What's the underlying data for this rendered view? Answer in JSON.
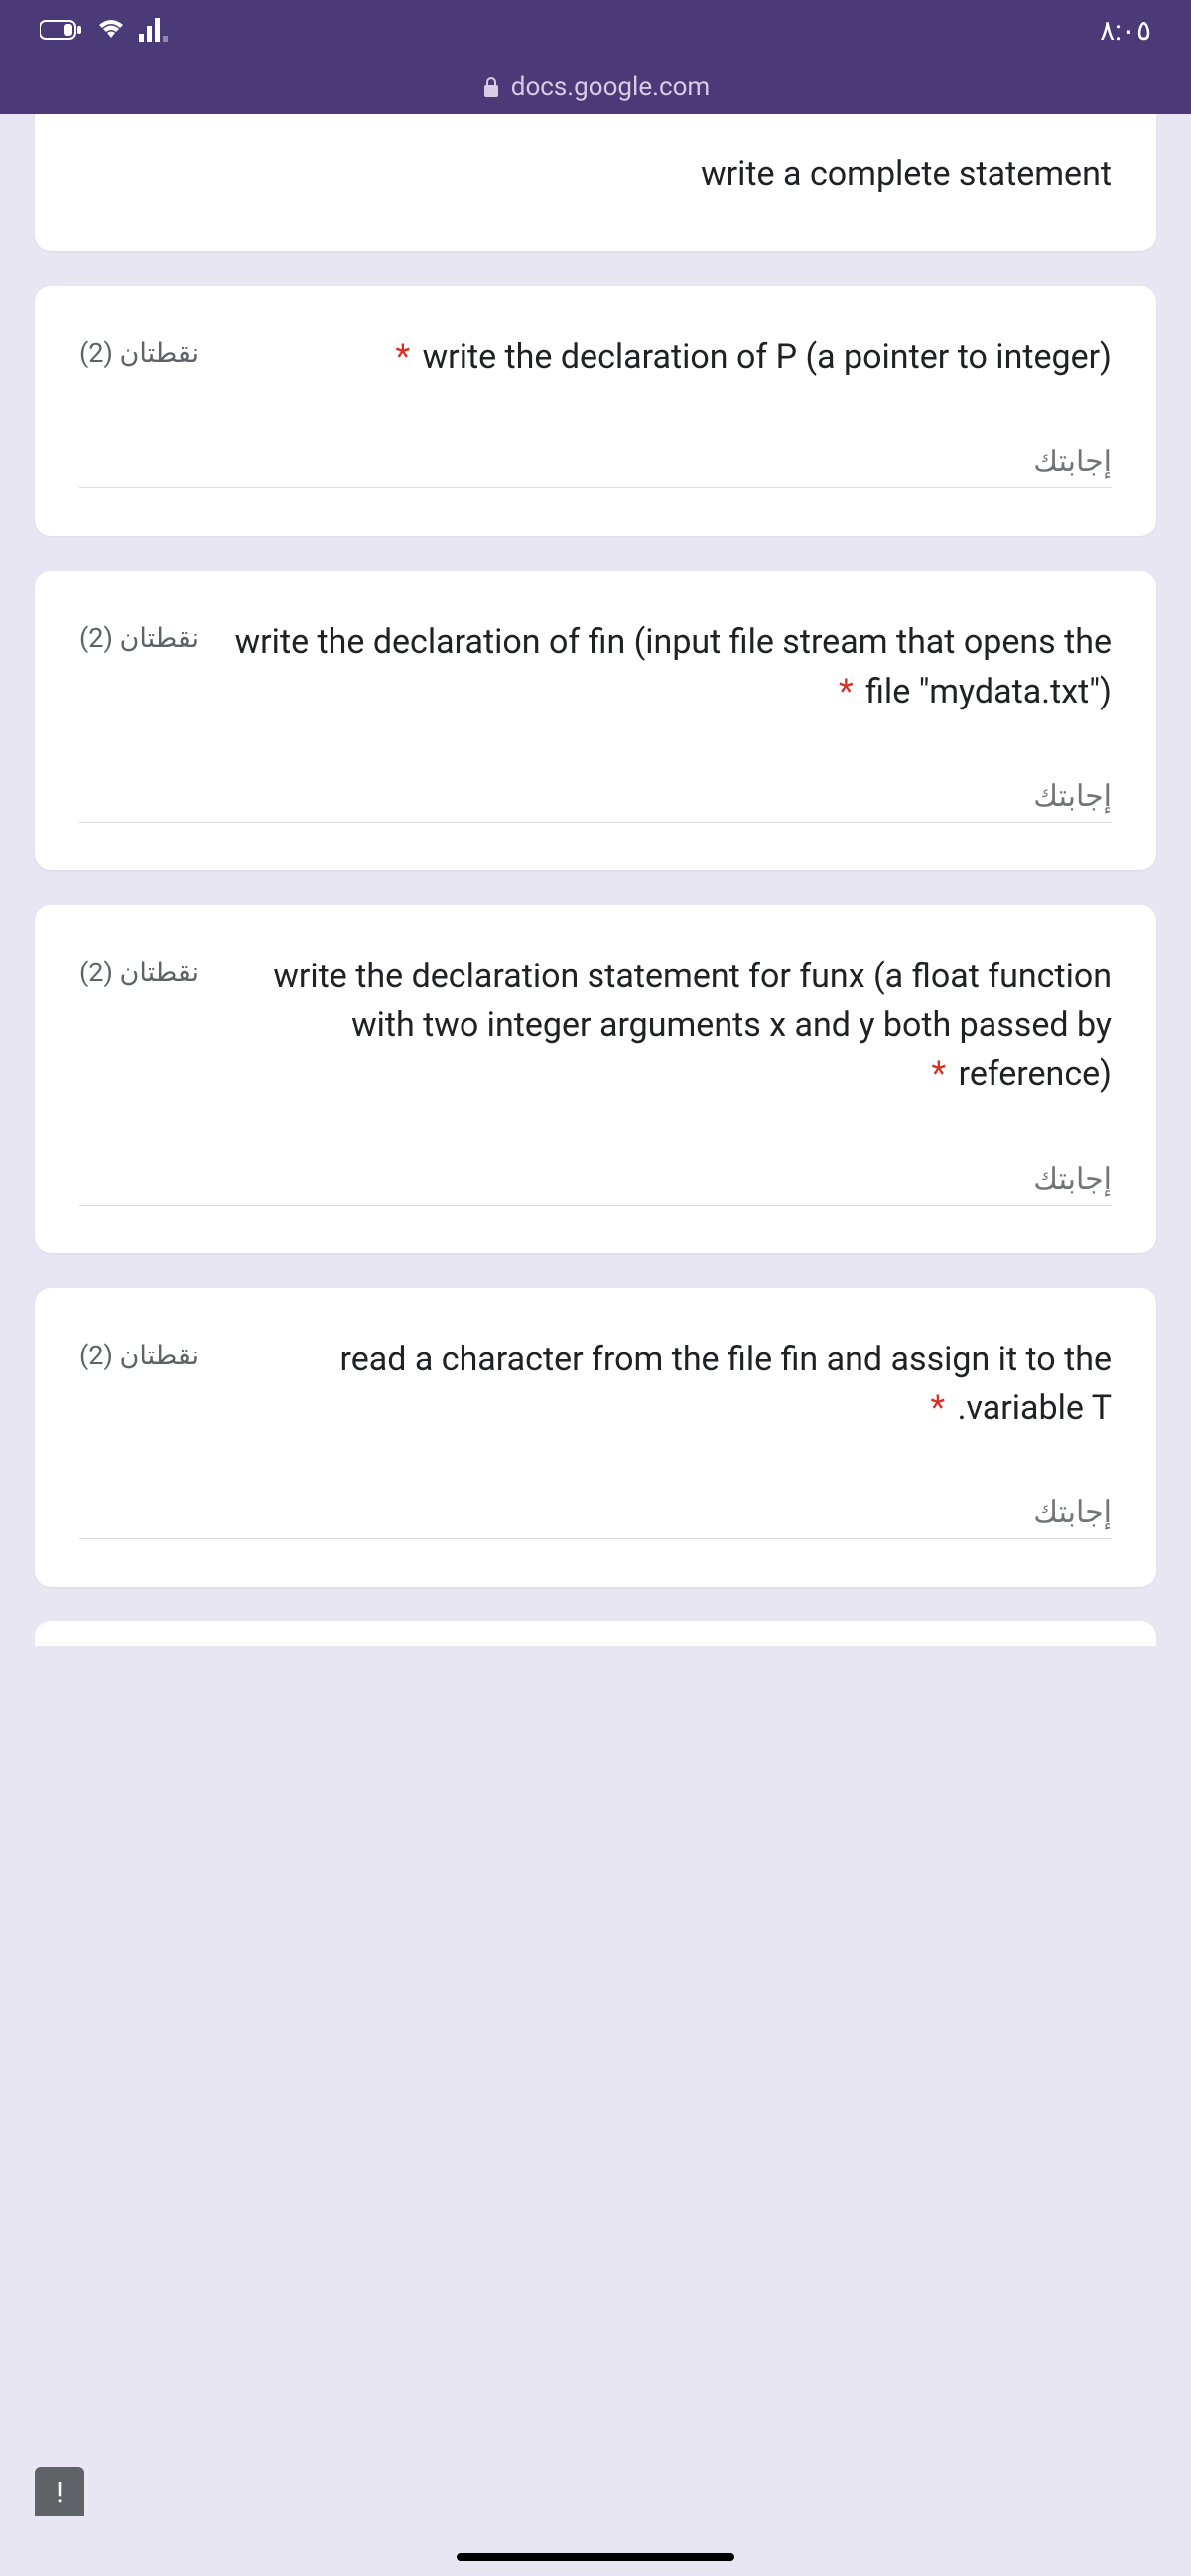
{
  "status": {
    "time": "٨:٠٥"
  },
  "url": "docs.google.com",
  "partial_top": {
    "text": "write a complete statement"
  },
  "questions": [
    {
      "text": "write the declaration of P (a pointer to integer)",
      "points": "نقطتان (2)",
      "placeholder": "إجابتك"
    },
    {
      "text": "write the declaration of fin (input file stream that opens the file \"mydata.txt\")",
      "points": "نقطتان (2)",
      "placeholder": "إجابتك"
    },
    {
      "text": "write the declaration statement for funx (a float function with two integer arguments x and y both passed by reference)",
      "points": "نقطتان (2)",
      "placeholder": "إجابتك"
    },
    {
      "text": "read a character from the file fin and assign it to the variable T.",
      "points": "نقطتان (2)",
      "placeholder": "إجابتك"
    }
  ],
  "report_label": "!"
}
